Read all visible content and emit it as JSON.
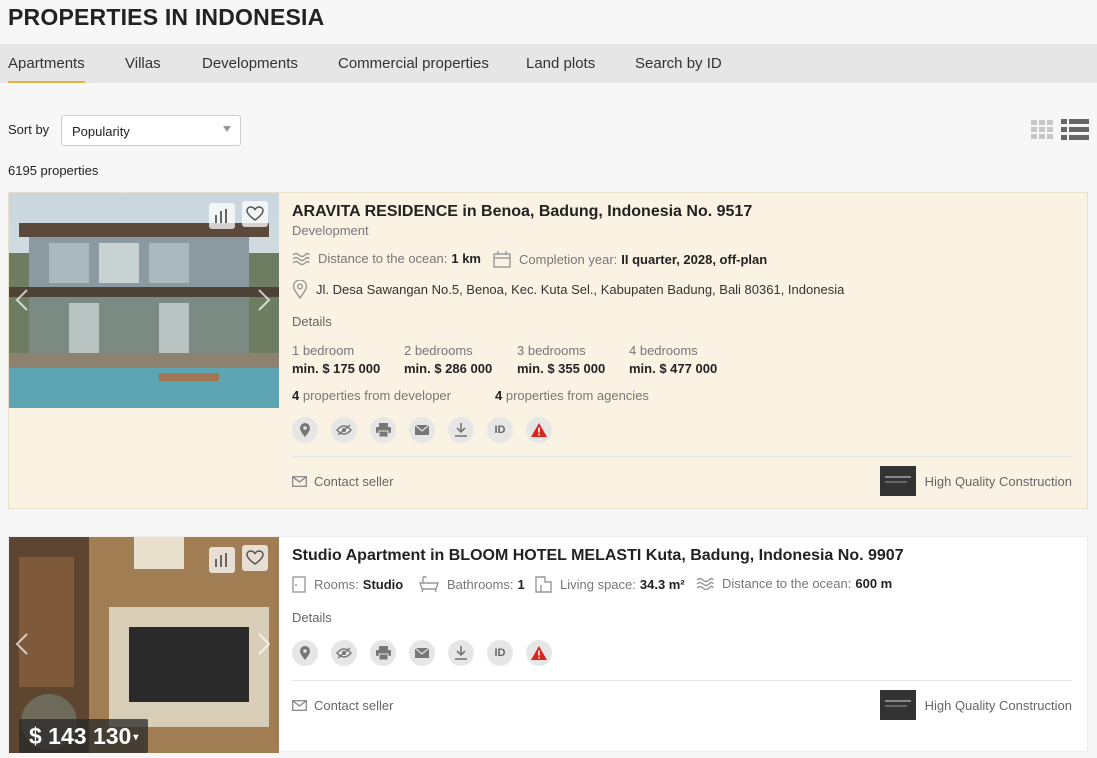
{
  "page_title": "PROPERTIES IN INDONESIA",
  "tabs": [
    {
      "label": "Apartments",
      "active": true
    },
    {
      "label": "Villas"
    },
    {
      "label": "Developments"
    },
    {
      "label": "Commercial properties"
    },
    {
      "label": "Land plots"
    },
    {
      "label": "Search by ID"
    }
  ],
  "sort": {
    "label": "Sort by",
    "value": "Popularity"
  },
  "count": "6195 properties",
  "listings": [
    {
      "title": "ARAVITA RESIDENCE in Benoa, Badung, Indonesia No. 9517",
      "type": "Development",
      "ocean_label": "Distance to the ocean:",
      "ocean_value": "1 km",
      "completion_label": "Completion year:",
      "completion_value": "II quarter, 2028, off-plan",
      "address": "Jl. Desa Sawangan No.5, Benoa, Kec. Kuta Sel., Kabupaten Badung, Bali 80361, Indonesia",
      "details": "Details",
      "bedrooms": [
        {
          "label": "1 bedroom",
          "price": "min. $ 175 000"
        },
        {
          "label": "2 bedrooms",
          "price": "min. $ 286 000"
        },
        {
          "label": "3 bedrooms",
          "price": "min. $ 355 000"
        },
        {
          "label": "4 bedrooms",
          "price": "min. $ 477 000"
        }
      ],
      "dev_count": "4",
      "dev_label": "properties from developer",
      "agency_count": "4",
      "agency_label": "properties from agencies",
      "id_label": "ID",
      "contact": "Contact seller",
      "seller": "High Quality Construction"
    },
    {
      "title": "Studio Apartment in BLOOM HOTEL MELASTI Kuta, Badung, Indonesia No. 9907",
      "rooms_label": "Rooms:",
      "rooms_value": "Studio",
      "bath_label": "Bathrooms:",
      "bath_value": "1",
      "space_label": "Living space:",
      "space_value": "34.3 m²",
      "ocean_label": "Distance to the ocean:",
      "ocean_value": "600 m",
      "details": "Details",
      "id_label": "ID",
      "contact": "Contact seller",
      "seller": "High Quality Construction",
      "price": "$ 143 130"
    }
  ],
  "colors": {
    "accent": "#e8b23a",
    "highlight_bg": "#faf3e3",
    "alert": "#d9261c"
  }
}
